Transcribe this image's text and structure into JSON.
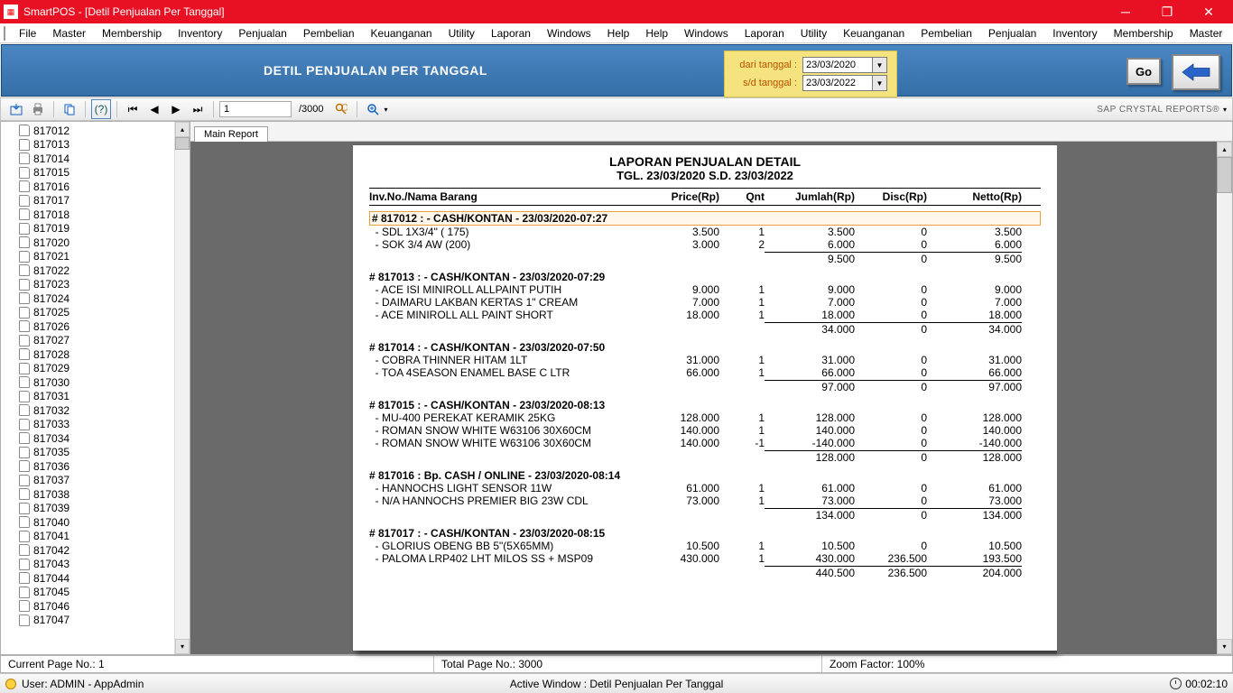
{
  "titlebar": {
    "text": "SmartPOS - [Detil Penjualan Per Tanggal]"
  },
  "menu": [
    "File",
    "Master",
    "Membership",
    "Inventory",
    "Penjualan",
    "Pembelian",
    "Keuanganan",
    "Utility",
    "Laporan",
    "Windows",
    "Help"
  ],
  "header": {
    "title": "DETIL PENJUALAN PER TANGGAL",
    "from_label": "dari tanggal :",
    "to_label": "s/d tanggal :",
    "from_value": "23/03/2020",
    "to_value": "23/03/2022",
    "go_label": "Go"
  },
  "toolbar": {
    "page_input": "1",
    "page_total": "/3000",
    "brand": "SAP CRYSTAL REPORTS®"
  },
  "tree": [
    "817012",
    "817013",
    "817014",
    "817015",
    "817016",
    "817017",
    "817018",
    "817019",
    "817020",
    "817021",
    "817022",
    "817023",
    "817024",
    "817025",
    "817026",
    "817027",
    "817028",
    "817029",
    "817030",
    "817031",
    "817032",
    "817033",
    "817034",
    "817035",
    "817036",
    "817037",
    "817038",
    "817039",
    "817040",
    "817041",
    "817042",
    "817043",
    "817044",
    "817045",
    "817046",
    "817047"
  ],
  "tab": "Main Report",
  "report": {
    "title1": "LAPORAN PENJUALAN DETAIL",
    "title2": "TGL. 23/03/2020 S.D. 23/03/2022",
    "head": {
      "name": "Inv.No./Nama Barang",
      "price": "Price(Rp)",
      "qnt": "Qnt",
      "jumlah": "Jumlah(Rp)",
      "disc": "Disc(Rp)",
      "netto": "Netto(Rp)"
    },
    "groups": [
      {
        "header": "# 817012 : - CASH/KONTAN - 23/03/2020-07:27",
        "highlight": true,
        "rows": [
          {
            "name": "- SDL 1X3/4\" ( 175)",
            "price": "3.500",
            "qnt": "1",
            "jumlah": "3.500",
            "disc": "0",
            "netto": "3.500"
          },
          {
            "name": "- SOK 3/4 AW (200)",
            "price": "3.000",
            "qnt": "2",
            "jumlah": "6.000",
            "disc": "0",
            "netto": "6.000"
          }
        ],
        "sub": {
          "jumlah": "9.500",
          "disc": "0",
          "netto": "9.500"
        }
      },
      {
        "header": "# 817013 : - CASH/KONTAN - 23/03/2020-07:29",
        "rows": [
          {
            "name": "- ACE ISI MINIROLL ALLPAINT PUTIH",
            "price": "9.000",
            "qnt": "1",
            "jumlah": "9.000",
            "disc": "0",
            "netto": "9.000"
          },
          {
            "name": "- DAIMARU LAKBAN KERTAS 1\" CREAM",
            "price": "7.000",
            "qnt": "1",
            "jumlah": "7.000",
            "disc": "0",
            "netto": "7.000"
          },
          {
            "name": "- ACE MINIROLL ALL PAINT SHORT",
            "price": "18.000",
            "qnt": "1",
            "jumlah": "18.000",
            "disc": "0",
            "netto": "18.000"
          }
        ],
        "sub": {
          "jumlah": "34.000",
          "disc": "0",
          "netto": "34.000"
        }
      },
      {
        "header": "# 817014 : - CASH/KONTAN - 23/03/2020-07:50",
        "rows": [
          {
            "name": "- COBRA THINNER HITAM 1LT",
            "price": "31.000",
            "qnt": "1",
            "jumlah": "31.000",
            "disc": "0",
            "netto": "31.000"
          },
          {
            "name": "- TOA 4SEASON ENAMEL BASE C  LTR",
            "price": "66.000",
            "qnt": "1",
            "jumlah": "66.000",
            "disc": "0",
            "netto": "66.000"
          }
        ],
        "sub": {
          "jumlah": "97.000",
          "disc": "0",
          "netto": "97.000"
        }
      },
      {
        "header": "# 817015 : - CASH/KONTAN - 23/03/2020-08:13",
        "rows": [
          {
            "name": "- MU-400 PEREKAT KERAMIK 25KG",
            "price": "128.000",
            "qnt": "1",
            "jumlah": "128.000",
            "disc": "0",
            "netto": "128.000"
          },
          {
            "name": "- ROMAN SNOW WHITE W63106 30X60CM",
            "price": "140.000",
            "qnt": "1",
            "jumlah": "140.000",
            "disc": "0",
            "netto": "140.000"
          },
          {
            "name": "- ROMAN SNOW WHITE W63106 30X60CM",
            "price": "140.000",
            "qnt": "-1",
            "jumlah": "-140.000",
            "disc": "0",
            "netto": "-140.000"
          }
        ],
        "sub": {
          "jumlah": "128.000",
          "disc": "0",
          "netto": "128.000"
        }
      },
      {
        "header": "# 817016 : Bp. CASH / ONLINE - 23/03/2020-08:14",
        "rows": [
          {
            "name": "- HANNOCHS LIGHT SENSOR 11W",
            "price": "61.000",
            "qnt": "1",
            "jumlah": "61.000",
            "disc": "0",
            "netto": "61.000"
          },
          {
            "name": "- N/A HANNOCHS PREMIER BIG 23W CDL",
            "price": "73.000",
            "qnt": "1",
            "jumlah": "73.000",
            "disc": "0",
            "netto": "73.000"
          }
        ],
        "sub": {
          "jumlah": "134.000",
          "disc": "0",
          "netto": "134.000"
        }
      },
      {
        "header": "# 817017 : - CASH/KONTAN - 23/03/2020-08:15",
        "rows": [
          {
            "name": "- GLORIUS OBENG BB 5\"(5X65MM)",
            "price": "10.500",
            "qnt": "1",
            "jumlah": "10.500",
            "disc": "0",
            "netto": "10.500"
          },
          {
            "name": "- PALOMA LRP402 LHT MILOS SS + MSP09",
            "price": "430.000",
            "qnt": "1",
            "jumlah": "430.000",
            "disc": "236.500",
            "netto": "193.500"
          }
        ],
        "sub": {
          "jumlah": "440.500",
          "disc": "236.500",
          "netto": "204.000"
        }
      }
    ]
  },
  "status": {
    "current_page": "Current Page No.: 1",
    "total_page": "Total Page No.: 3000",
    "zoom": "Zoom Factor: 100%",
    "user": "User: ADMIN - AppAdmin",
    "active": "Active Window : Detil Penjualan Per Tanggal",
    "clock": "00:02:10"
  }
}
